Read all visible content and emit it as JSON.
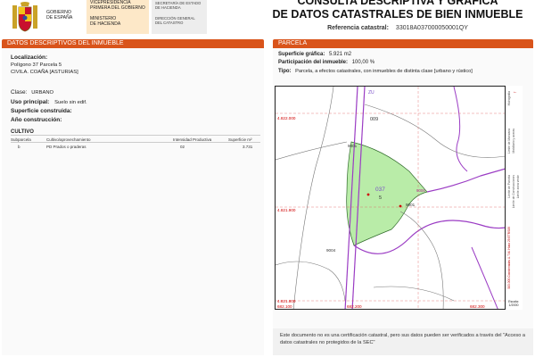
{
  "header": {
    "gov_lines": [
      "GOBIERNO",
      "DE ESPAÑA"
    ],
    "ministry1_lines": [
      "VICEPRESIDENCIA",
      "PRIMERA DEL GOBIERNO"
    ],
    "ministry2_lines": [
      "MINISTERIO",
      "DE HACIENDA"
    ],
    "sec1_lines": [
      "SECRETARÍA DE ESTADO",
      "DE HACIENDA"
    ],
    "sec2_lines": [
      "DIRECCIÓN GENERAL",
      "DEL CATASTRO"
    ],
    "title_line1": "CONSULTA DESCRIPTIVA Y GRÁFICA",
    "title_line2": "DE DATOS CATASTRALES DE BIEN INMUEBLE",
    "ref_label": "Referencia catastral:",
    "ref_value": "33018A037000050001QY"
  },
  "left": {
    "bar_title": "DATOS DESCRIPTIVOS DEL INMUEBLE",
    "loc_label": "Localización:",
    "loc_line1": "Polígono 37 Parcela 5",
    "loc_line2": "CIVILA. COAÑA [ASTURIAS]",
    "clase_label": "Clase:",
    "clase_value": "URBANO",
    "uso_label": "Uso principal:",
    "uso_value": "Suelo sin edif.",
    "sup_label": "Superficie construida:",
    "anio_label": "Año construcción:",
    "cultivo_title": "CULTIVO",
    "cultivo_headers": [
      "Subparcela",
      "Cultivo/aprovechamiento",
      "Intensidad Productiva",
      "Superficie m²"
    ],
    "cultivo_row": [
      "b",
      "PD Prados o praderas",
      "02",
      "3.731"
    ]
  },
  "right": {
    "bar_title": "PARCELA",
    "sup_label": "Superficie gráfica:",
    "sup_value": "5.921 m2",
    "part_label": "Participación del inmueble:",
    "part_value": "100,00 %",
    "tipo_label": "Tipo:",
    "tipo_value": "Parcela, a efectos catastrales, con inmuebles de distinta clase [urbano y rústico]",
    "map": {
      "coord_top": "4.822.000",
      "coord_mid": "4.821.900",
      "coord_bot": "4.821.800",
      "coord_x1": "682.100",
      "coord_x2": "682.200",
      "coord_x3": "682.300",
      "labels": [
        "009",
        "9001",
        "037",
        "5",
        "9001",
        "9006",
        "9004",
        "ZU"
      ],
      "legend": [
        "Límite de Manzana",
        "Límite de Parcela",
        "Límite de Construcciones",
        "Mobiliario y aceras",
        "Límite zona verde",
        "Hidrografía"
      ],
      "projection": "583.000 Coordenadas U.T.M. Huso 29 ETRS89",
      "scale_label": "Escala:",
      "scale_value": "1/2000"
    },
    "note": "Este documento no es una certificación catastral, pero sus datos pueden ser verificados a través del \"Acceso a datos catastrales no protegidos de la SEC\""
  },
  "colors": {
    "accent": "#d9541b",
    "parcel_fill": "#b9eca8",
    "parcel_line": "#9b3cc4"
  }
}
